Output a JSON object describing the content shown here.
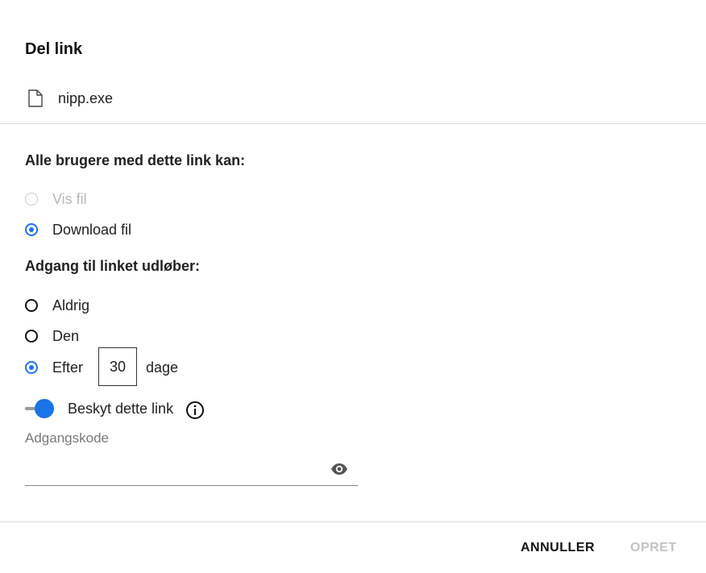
{
  "dialog": {
    "title": "Del link",
    "file_name": "nipp.exe"
  },
  "permissions": {
    "label": "Alle brugere med dette link kan:",
    "options": [
      {
        "label": "Vis fil",
        "state": "disabled"
      },
      {
        "label": "Download fil",
        "state": "selected"
      }
    ]
  },
  "expiry": {
    "label": "Adgang til linket udløber:",
    "options": [
      {
        "label": "Aldrig",
        "state": "unselected"
      },
      {
        "label": "Den",
        "state": "unselected"
      },
      {
        "label": "Efter",
        "state": "selected"
      }
    ],
    "days_value": "30",
    "days_unit": "dage"
  },
  "protect": {
    "label": "Beskyt dette link",
    "enabled": true
  },
  "password": {
    "label": "Adgangskode",
    "value": ""
  },
  "buttons": {
    "cancel": "ANNULLER",
    "create": "OPRET"
  },
  "colors": {
    "accent": "#1a73e8",
    "disabled": "#c4c4c4"
  },
  "icons": [
    "file-icon",
    "info-icon",
    "eye-icon"
  ]
}
